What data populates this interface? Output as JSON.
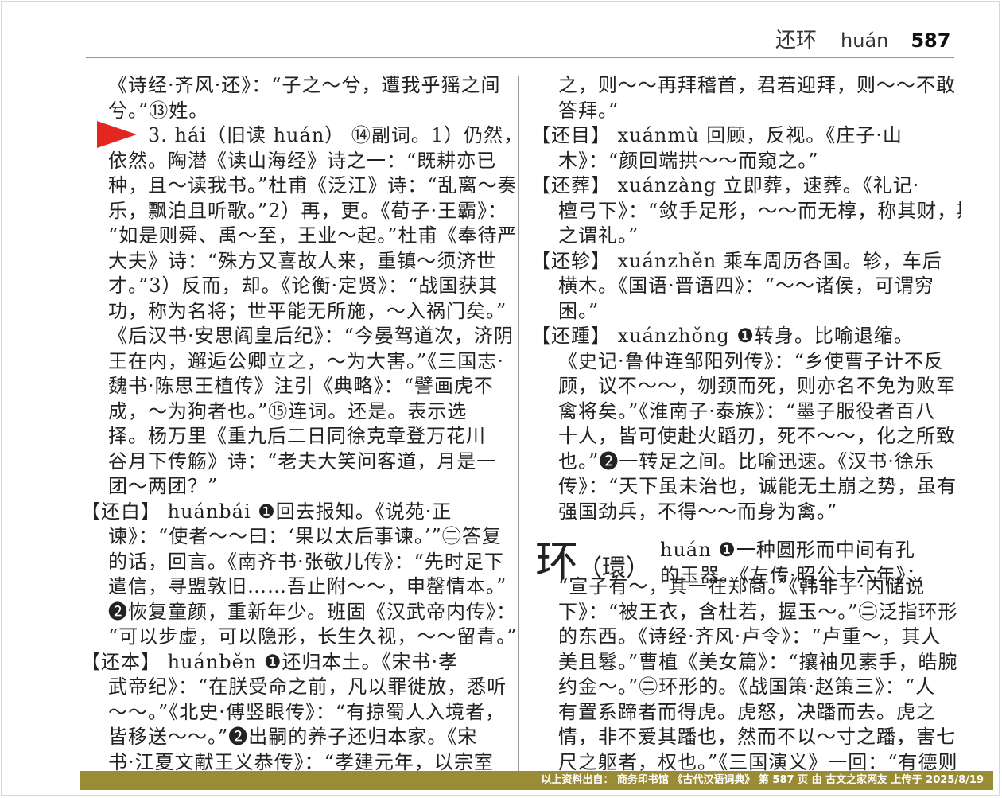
{
  "header": {
    "headword": "还环",
    "pinyin": "huán",
    "page_number": "587"
  },
  "left_column": [
    "《诗经·齐风·还》：“子之～兮，遭我乎猺之间",
    "兮。”⑬姓。",
    "3. hái（旧读 huán） ⑭副词。1）仍然，",
    "依然。陶潜《读山海经》诗之一：“既耕亦已",
    "种，且～读我书。”杜甫《泛江》诗：“乱离～奏",
    "乐，飘泊且听歌。”2）再，更。《荀子·王霸》：",
    "“如是则舜、禹～至，王业～起。”杜甫《奉待严",
    "大夫》诗：“殊方又喜故人来，重镇～须济世",
    "才。”3）反而，却。《论衡·定贤》：“战国获其",
    "功，称为名将；世平能无所施，～入祸门矣。”",
    "《后汉书·安思阎皇后纪》：“今晏驾道次，济阴",
    "王在内，邂逅公卿立之，～为大害。”《三国志·",
    "魏书·陈思王植传》注引《典略》：“譬画虎不",
    "成，～为狗者也。”⑮连词。还是。表示选",
    "择。杨万里《重九后二日同徐克章登万花川",
    "谷月下传觞》诗：“老夫大笑问客道，月是一",
    "团～两团？”",
    "【还白】 huánbái ❶回去报知。《说苑·正",
    "谏》：“使者～～曰：‘果以太后事谏。’”㊁答复",
    "的话，回言。《南齐书·张敬儿传》：“先时足下",
    "遣信，寻盟敦旧……吾止附～～，申罄情本。”",
    "❷恢复童颜，重新年少。班固《汉武帝内传》：",
    "“可以步虚，可以隐形，长生久视，～～留青。”",
    "【还本】 huánběn ❶还归本土。《宋书·孝",
    "武帝纪》：“在朕受命之前，凡以罪徙放，悉听",
    "～～。”《北史·傅竖眼传》：“有掠蜀人入境者，",
    "皆移送～～。”❷出嗣的养子还归本家。《宋",
    "书·江夏文献王义恭传》：“孝建元年，以宗室"
  ],
  "right_column": [
    "之，则～～再拜稽首，君若迎拜，则～～不敢",
    "答拜。”",
    "【还目】 xuánmù 回顾，反视。《庄子·山",
    "木》：“颜回端拱～～而窥之。”",
    "【还葬】 xuánzàng 立即葬，速葬。《礼记·",
    "檀弓下》：“敛手足形，～～而无椁，称其财，斯",
    "之谓礼。”",
    "【还轸】 xuánzhěn 乘车周历各国。轸，车后",
    "横木。《国语·晋语四》：“～～诸侯，可谓穷",
    "困。”",
    "【还踵】 xuánzhǒng ❶转身。比喻退缩。",
    "《史记·鲁仲连邹阳列传》：“乡使曹子计不反",
    "顾，议不～～，刎颈而死，则亦名不免为败军",
    "禽将矣。”《淮南子·泰族》：“墨子服役者百八",
    "十人，皆可使赴火蹈刃，死不～～，化之所致",
    "也。”❷一转足之间。比喻迅速。《汉书·徐乐",
    "传》：“天下虽未治也，诚能无土崩之势，虽有",
    "强国劲兵，不得～～而身为禽。”",
    "",
    "",
    "“宣子有～，其一在郑商。”《韩非子·内储说",
    "下》：“被王衣，含杜若，握玉～。”㊁泛指环形",
    "的东西。《诗经·齐风·卢令》：“卢重～，其人",
    "美且鬈。”曹植《美女篇》：“攘袖见素手，皓腕",
    "约金～。”㊁环形的。《战国策·赵策三》：“人",
    "有置系蹄者而得虎。虎怒，决蹯而去。虎之",
    "情，非不爱其蹯也，然而不以～寸之蹯，害七",
    "尺之躯者，权也。”《三国演义》一回：“有德则"
  ],
  "huan_entry": {
    "char": "环",
    "traditional": "（環）",
    "line1": "huán ❶一种圆形而中间有孔",
    "line2": "的玉器。《左传·昭公十六年》："
  },
  "footer": "以上资料出自： 商务印书馆 《古代汉语词典》 第 587 页 由 古文之家网友 上传于 2025/8/19"
}
